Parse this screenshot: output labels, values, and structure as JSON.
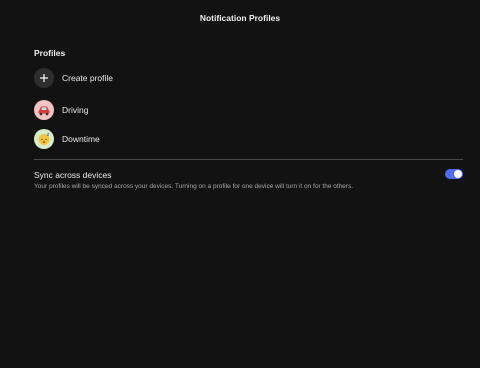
{
  "header": {
    "title": "Notification Profiles"
  },
  "profiles": {
    "section_title": "Profiles",
    "create_label": "Create profile",
    "create_icon": "plus-icon",
    "items": [
      {
        "label": "Driving",
        "icon": "car-icon",
        "icon_bg": "#f4c3c3"
      },
      {
        "label": "Downtime",
        "icon": "sleeping-face-icon",
        "icon_bg": "#d7ecc8"
      }
    ]
  },
  "sync": {
    "title": "Sync across devices",
    "description": "Your profiles will be synced across your devices. Turning on a profile for one device will turn it on for the others.",
    "enabled": true,
    "accent_color": "#4f6bf0"
  }
}
